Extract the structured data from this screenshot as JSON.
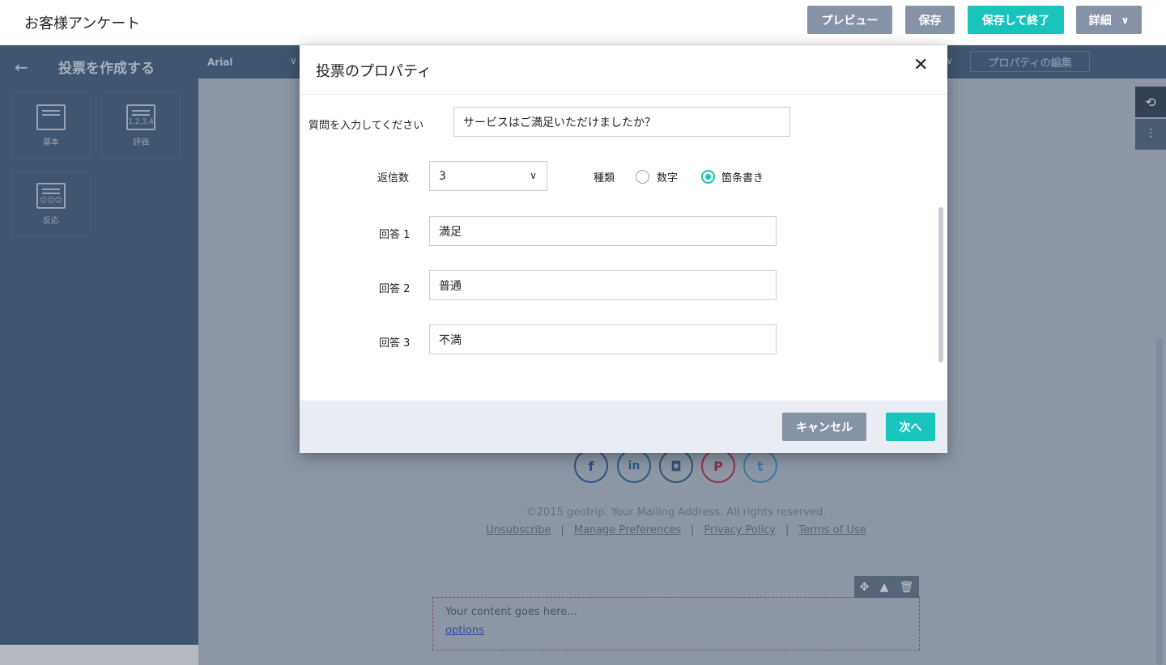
{
  "header": {
    "title": "お客様アンケート",
    "buttons": {
      "preview": "プレビュー",
      "save": "保存",
      "save_exit": "保存して終了",
      "details": "詳細"
    }
  },
  "sidebar": {
    "title": "投票を作成する",
    "widgets": [
      {
        "label": "基本",
        "glyph": ""
      },
      {
        "label": "評価",
        "glyph": "1,2,3,4"
      },
      {
        "label": "反応",
        "glyph": "☺☺☺"
      }
    ]
  },
  "toolbar": {
    "font": "Arial",
    "edit_properties": "プロパティの編集"
  },
  "footer": {
    "copyright": "©2015 geotrip. Your Mailing Address. All rights reserved.",
    "links": [
      "Unsubscribe",
      "Manage Preferences",
      "Privacy Policy",
      "Terms of Use"
    ],
    "separator": "|",
    "social": [
      "f",
      "in",
      "◘",
      "P",
      "t"
    ]
  },
  "content_block": {
    "text": "Your content goes here...",
    "link": "options"
  },
  "modal": {
    "title": "投票のプロパティ",
    "question_label": "質問を入力してください",
    "question_value": "サービスはご満足いただけましたか？",
    "reply_count_label": "返信数",
    "reply_count_value": "3",
    "type_label": "種類",
    "type_options": [
      "数字",
      "箇条書き"
    ],
    "type_selected": "箇条書き",
    "answers": [
      {
        "label": "回答 1",
        "value": "満足"
      },
      {
        "label": "回答 2",
        "value": "普通"
      },
      {
        "label": "回答 3",
        "value": "不満"
      }
    ],
    "cancel": "キャンセル",
    "next": "次へ"
  },
  "colors": {
    "accent": "#19c4bd",
    "button_grey": "#8793a6",
    "sidebar": "#4b6382"
  }
}
